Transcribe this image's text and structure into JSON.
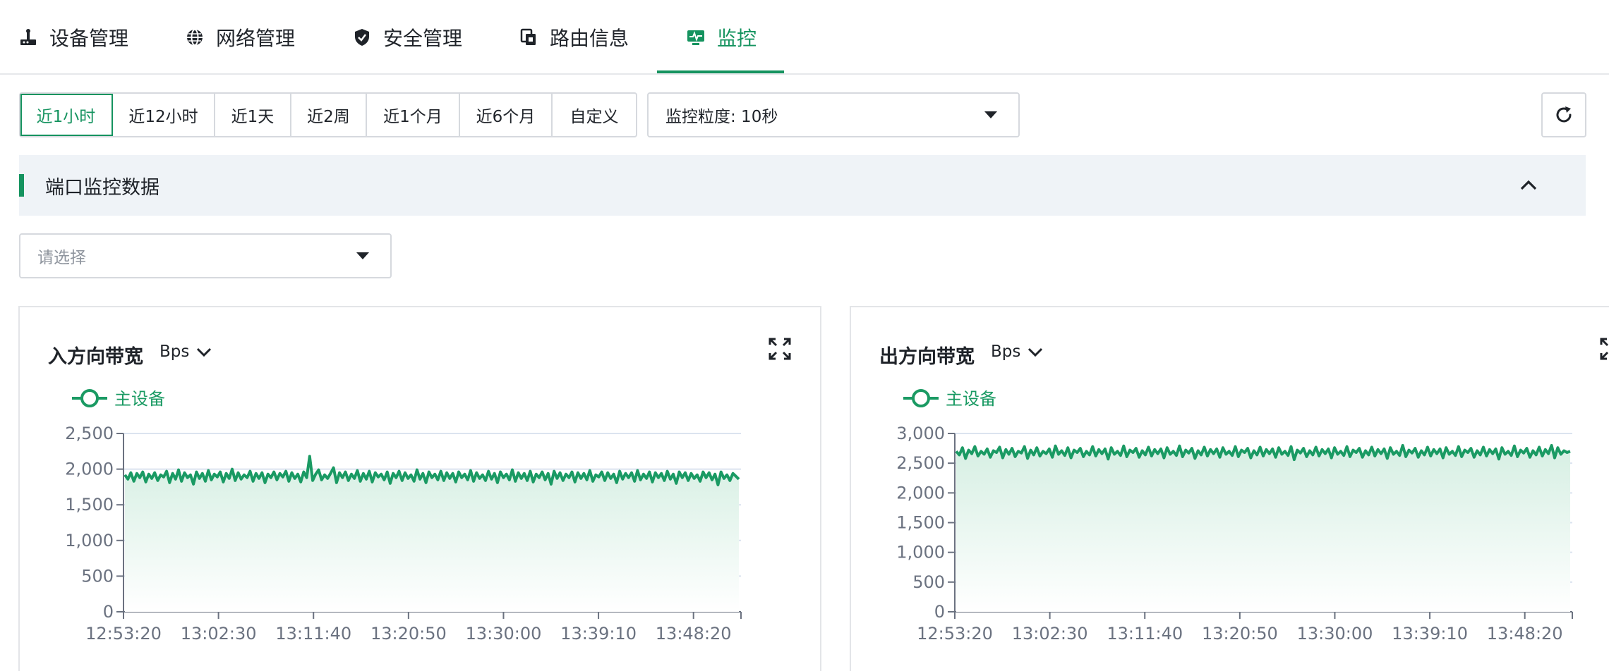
{
  "tabs": [
    {
      "label": "设备管理",
      "icon": "device-icon"
    },
    {
      "label": "网络管理",
      "icon": "globe-icon"
    },
    {
      "label": "安全管理",
      "icon": "shield-icon"
    },
    {
      "label": "路由信息",
      "icon": "route-icon"
    },
    {
      "label": "监控",
      "icon": "monitor-icon",
      "active": true
    }
  ],
  "toolbar": {
    "time_ranges": [
      "近1小时",
      "近12小时",
      "近1天",
      "近2周",
      "近1个月",
      "近6个月",
      "自定义"
    ],
    "selected_range": "近1小时",
    "granularity": "监控粒度: 10秒",
    "refresh_icon": "refresh-icon"
  },
  "section": {
    "title": "端口监控数据",
    "port_select_placeholder": "请选择"
  },
  "colors": {
    "accent": "#15935f",
    "line": "#1a9a63",
    "area_top": "#d6efe3",
    "grid": "#dbe3ef"
  },
  "charts": [
    {
      "title": "入方向带宽",
      "unit": "Bps",
      "legend": "主设备"
    },
    {
      "title": "出方向带宽",
      "unit": "Bps",
      "legend": "主设备"
    }
  ],
  "chart_data": [
    {
      "type": "area",
      "title": "入方向带宽",
      "ylabel": "Bps",
      "ylim": [
        0,
        2500
      ],
      "yticks": [
        "0",
        "500",
        "1,000",
        "1,500",
        "2,000",
        "2,500"
      ],
      "x_tick_labels": [
        "12:53:20",
        "13:02:30",
        "13:11:40",
        "13:20:50",
        "13:30:00",
        "13:39:10",
        "13:48:20"
      ],
      "x_start": "12:53:20",
      "x_end": "13:53:10",
      "series": [
        {
          "name": "主设备",
          "values": [
            1920,
            1860,
            1950,
            1830,
            1940,
            1880,
            1960,
            1820,
            1930,
            1870,
            1950,
            1840,
            1920,
            1890,
            1970,
            1810,
            1940,
            1860,
            1990,
            1830,
            1950,
            1880,
            1920,
            1790,
            1960,
            1870,
            1940,
            1830,
            1980,
            1850,
            1930,
            1890,
            1960,
            1820,
            1940,
            1870,
            2000,
            1840,
            1950,
            1860,
            1920,
            1880,
            1970,
            1830,
            1940,
            1870,
            1950,
            1810,
            1930,
            1880,
            1960,
            1850,
            1940,
            1890,
            1970,
            1830,
            1950,
            1870,
            1930,
            1820,
            1960,
            1880,
            2180,
            1840,
            1930,
            1990,
            1850,
            1920,
            1870,
            1940,
            2020,
            1810,
            1950,
            1880,
            1960,
            1840,
            1930,
            1870,
            1980,
            1830,
            1940,
            1860,
            1970,
            1820,
            1950,
            1890,
            1930,
            1850,
            1960,
            1800,
            1940,
            1880,
            1970,
            1840,
            1950,
            1870,
            1920,
            1830,
            1990,
            1860,
            1940,
            1810,
            1960,
            1880,
            1930,
            1850,
            1970,
            1840,
            1950,
            1870,
            1940,
            1820,
            1960,
            1880,
            1930,
            1850,
            1980,
            1830,
            1950,
            1870,
            1920,
            1840,
            1970,
            1860,
            1940,
            1810,
            1960,
            1880,
            1930,
            1850,
            1990,
            1830,
            1950,
            1870,
            1940,
            1840,
            1970,
            1820,
            1930,
            1880,
            1960,
            1850,
            1940,
            1790,
            1970,
            1870,
            1950,
            1840,
            1930,
            1880,
            1960,
            1820,
            1950,
            1870,
            1940,
            1850,
            1980,
            1830,
            1920,
            1890,
            1960,
            1840,
            1950,
            1870,
            1930,
            1810,
            1970,
            1860,
            1940,
            1880,
            1950,
            1830,
            1980,
            1850,
            1930,
            1870,
            1960,
            1820,
            1950,
            1880,
            1940,
            1840,
            1970,
            1860,
            1930,
            1800,
            1960,
            1880,
            1950,
            1840,
            1940,
            1870,
            1920,
            1830,
            1960,
            1880,
            1950,
            1850,
            1930,
            1780,
            1960,
            1870,
            1920,
            1840,
            1940,
            1900,
            1860
          ]
        }
      ],
      "legend": "top-left",
      "grid": true
    },
    {
      "type": "area",
      "title": "出方向带宽",
      "ylabel": "Bps",
      "ylim": [
        0,
        3000
      ],
      "yticks": [
        "0",
        "500",
        "1,000",
        "1,500",
        "2,000",
        "2,500",
        "3,000"
      ],
      "x_tick_labels": [
        "12:53:20",
        "13:02:30",
        "13:11:40",
        "13:20:50",
        "13:30:00",
        "13:39:10",
        "13:48:20"
      ],
      "x_start": "12:53:20",
      "x_end": "13:53:10",
      "series": [
        {
          "name": "主设备",
          "values": [
            2700,
            2640,
            2760,
            2580,
            2720,
            2660,
            2780,
            2620,
            2700,
            2650,
            2740,
            2600,
            2710,
            2680,
            2770,
            2590,
            2730,
            2650,
            2750,
            2610,
            2700,
            2670,
            2780,
            2580,
            2720,
            2640,
            2760,
            2620,
            2700,
            2660,
            2740,
            2600,
            2790,
            2650,
            2710,
            2630,
            2760,
            2590,
            2720,
            2680,
            2750,
            2610,
            2700,
            2640,
            2780,
            2620,
            2730,
            2660,
            2740,
            2570,
            2760,
            2650,
            2700,
            2630,
            2790,
            2610,
            2720,
            2680,
            2750,
            2600,
            2710,
            2640,
            2770,
            2620,
            2730,
            2660,
            2740,
            2590,
            2760,
            2650,
            2700,
            2630,
            2790,
            2610,
            2720,
            2670,
            2750,
            2580,
            2710,
            2640,
            2770,
            2620,
            2730,
            2660,
            2740,
            2600,
            2760,
            2650,
            2700,
            2630,
            2780,
            2610,
            2720,
            2680,
            2750,
            2590,
            2710,
            2640,
            2770,
            2620,
            2730,
            2660,
            2740,
            2600,
            2760,
            2650,
            2700,
            2630,
            2780,
            2560,
            2720,
            2670,
            2750,
            2610,
            2710,
            2640,
            2770,
            2620,
            2730,
            2660,
            2740,
            2590,
            2760,
            2650,
            2700,
            2630,
            2780,
            2610,
            2720,
            2680,
            2750,
            2600,
            2710,
            2640,
            2770,
            2620,
            2730,
            2660,
            2740,
            2580,
            2760,
            2650,
            2700,
            2630,
            2800,
            2610,
            2720,
            2670,
            2750,
            2600,
            2710,
            2640,
            2770,
            2620,
            2730,
            2660,
            2740,
            2590,
            2760,
            2650,
            2700,
            2630,
            2780,
            2610,
            2720,
            2680,
            2750,
            2600,
            2710,
            2640,
            2770,
            2620,
            2730,
            2660,
            2740,
            2570,
            2760,
            2650,
            2700,
            2630,
            2790,
            2610,
            2720,
            2670,
            2750,
            2600,
            2710,
            2640,
            2770,
            2620,
            2730,
            2660,
            2800,
            2590,
            2760,
            2650,
            2710,
            2680,
            2700
          ]
        }
      ],
      "legend": "top-left",
      "grid": true
    }
  ]
}
